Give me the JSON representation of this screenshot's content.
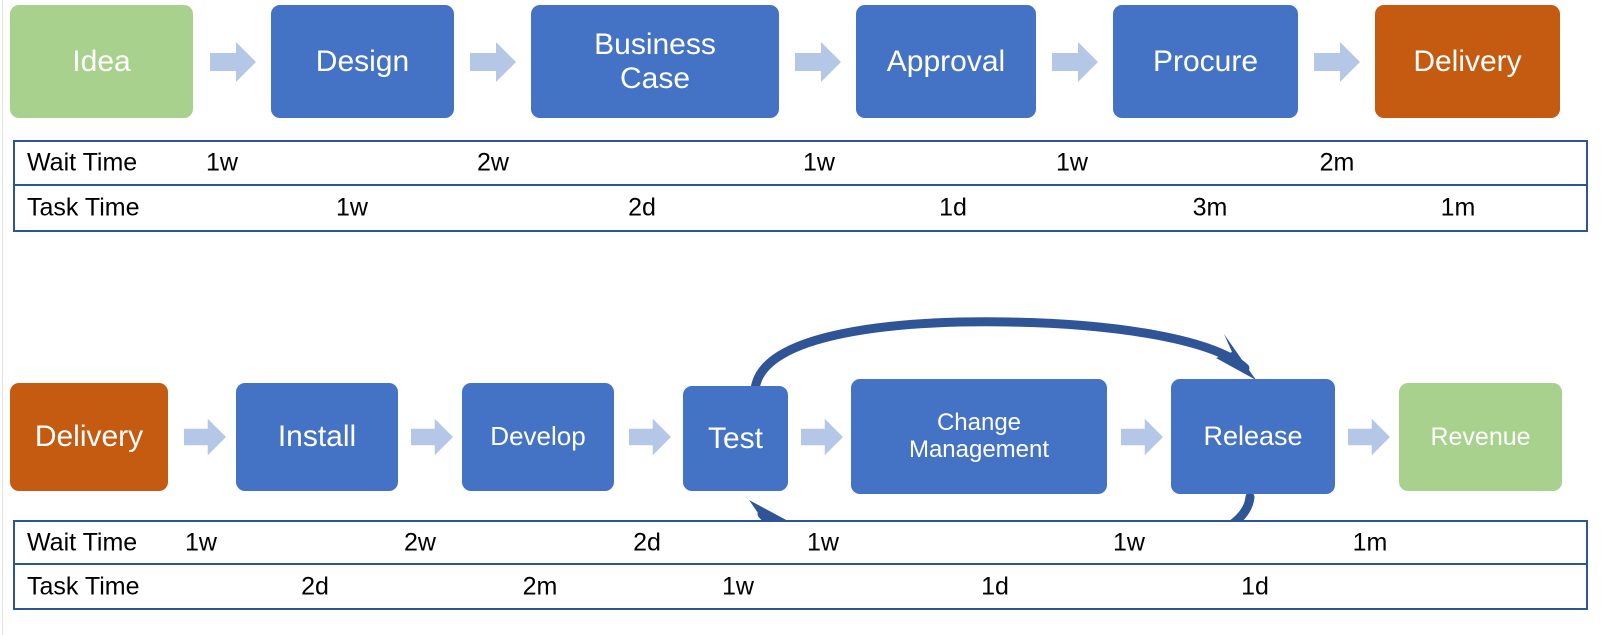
{
  "colors": {
    "process_blue": "#4472C4",
    "start_green": "#A9D18E",
    "end_orange": "#C55A11",
    "chevron_blue": "#B4C7E7",
    "table_border": "#2F5496",
    "loop_arrow": "#2F5597",
    "text_on_box": "#FFFFFF",
    "text_black": "#000000"
  },
  "top_stream": {
    "boxes": [
      {
        "label": "Idea",
        "style": "green",
        "font_size": 30
      },
      {
        "label": "Design",
        "style": "blue",
        "font_size": 30
      },
      {
        "label": "Business\nCase",
        "style": "blue",
        "font_size": 30
      },
      {
        "label": "Approval",
        "style": "blue",
        "font_size": 30
      },
      {
        "label": "Procure",
        "style": "blue",
        "font_size": 30
      },
      {
        "label": "Delivery",
        "style": "orange",
        "font_size": 30
      }
    ],
    "table": {
      "row_labels": [
        "Wait Time",
        "Task Time"
      ],
      "wait_values": [
        "1w",
        "2w",
        "1w",
        "1w",
        "2m"
      ],
      "task_values": [
        "1w",
        "2d",
        "1d",
        "3m",
        "1m"
      ]
    }
  },
  "bottom_stream": {
    "boxes": [
      {
        "label": "Delivery",
        "style": "orange",
        "font_size": 30
      },
      {
        "label": "Install",
        "style": "blue",
        "font_size": 30
      },
      {
        "label": "Develop",
        "style": "blue",
        "font_size": 26
      },
      {
        "label": "Test",
        "style": "blue",
        "font_size": 30
      },
      {
        "label": "Change\nManagement",
        "style": "blue",
        "font_size": 24
      },
      {
        "label": "Release",
        "style": "blue",
        "font_size": 27
      },
      {
        "label": "Revenue",
        "style": "green",
        "font_size": 25
      }
    ],
    "table": {
      "row_labels": [
        "Wait Time",
        "Task Time"
      ],
      "wait_values": [
        "1w",
        "2w",
        "2d",
        "1w",
        "1w",
        "1m"
      ],
      "task_values": [
        "2d",
        "2m",
        "1w",
        "1d",
        "1d"
      ]
    },
    "feedback_loop": {
      "from": "Release",
      "to": "Test",
      "description": "rework loop between Test and Release"
    }
  }
}
